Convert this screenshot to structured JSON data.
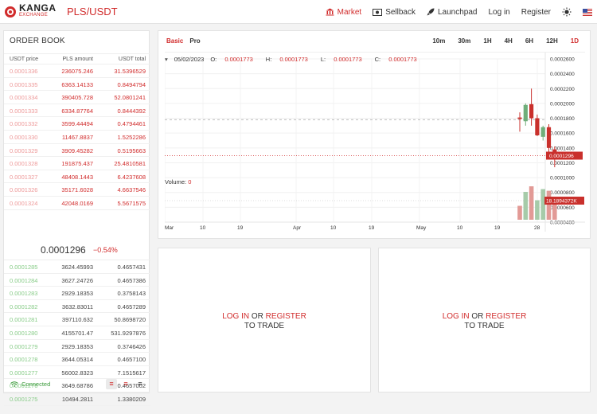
{
  "header": {
    "logo_text": "KANGA",
    "logo_sub": "EXCHANGE",
    "pair": "PLS/USDT",
    "nav": [
      {
        "label": "Market",
        "icon": "bank-icon",
        "active": true
      },
      {
        "label": "Sellback",
        "icon": "cash-icon",
        "active": false
      },
      {
        "label": "Launchpad",
        "icon": "rocket-icon",
        "active": false
      },
      {
        "label": "Log in",
        "icon": "",
        "active": false
      },
      {
        "label": "Register",
        "icon": "",
        "active": false
      }
    ]
  },
  "orderbook": {
    "title": "ORDER BOOK",
    "columns": [
      "USDT price",
      "PLS amount",
      "USDT total"
    ],
    "asks": [
      [
        "0.0001336",
        "236075.246",
        "31.5396529"
      ],
      [
        "0.0001335",
        "6363.14133",
        "0.8494794"
      ],
      [
        "0.0001334",
        "390405.728",
        "52.0801241"
      ],
      [
        "0.0001333",
        "6334.87764",
        "0.8444392"
      ],
      [
        "0.0001332",
        "3599.44494",
        "0.4794461"
      ],
      [
        "0.0001330",
        "11467.8837",
        "1.5252286"
      ],
      [
        "0.0001329",
        "3909.45282",
        "0.5195663"
      ],
      [
        "0.0001328",
        "191875.437",
        "25.4810581"
      ],
      [
        "0.0001327",
        "48408.1443",
        "6.4237608"
      ],
      [
        "0.0001326",
        "35171.6028",
        "4.6637546"
      ],
      [
        "0.0001324",
        "42048.0169",
        "5.5671575"
      ]
    ],
    "last_price": "0.0001296",
    "change": "−0.54%",
    "bids": [
      [
        "0.0001285",
        "3624.45993",
        "0.4657431"
      ],
      [
        "0.0001284",
        "3627.24726",
        "0.4657386"
      ],
      [
        "0.0001283",
        "2929.18353",
        "0.3758143"
      ],
      [
        "0.0001282",
        "3632.83011",
        "0.4657289"
      ],
      [
        "0.0001281",
        "397110.632",
        "50.8698720"
      ],
      [
        "0.0001280",
        "4155701.47",
        "531.9297876"
      ],
      [
        "0.0001279",
        "2929.18353",
        "0.3746426"
      ],
      [
        "0.0001278",
        "3644.05314",
        "0.4657100"
      ],
      [
        "0.0001277",
        "56002.8323",
        "7.1515617"
      ],
      [
        "0.0001276",
        "3649.68786",
        "0.4657002"
      ],
      [
        "0.0001275",
        "10494.2811",
        "1.3380209"
      ]
    ],
    "status": "Connected"
  },
  "chart": {
    "tabs": [
      {
        "label": "Basic",
        "active": true
      },
      {
        "label": "Pro",
        "active": false
      }
    ],
    "intervals": [
      {
        "label": "10m",
        "active": false
      },
      {
        "label": "30m",
        "active": false
      },
      {
        "label": "1H",
        "active": false
      },
      {
        "label": "4H",
        "active": false
      },
      {
        "label": "6H",
        "active": false
      },
      {
        "label": "12H",
        "active": false
      },
      {
        "label": "1D",
        "active": true
      }
    ],
    "date": "05/02/2023",
    "ohlc": [
      {
        "k": "O:",
        "v": "0.0001773"
      },
      {
        "k": "H:",
        "v": "0.0001773"
      },
      {
        "k": "L:",
        "v": "0.0001773"
      },
      {
        "k": "C:",
        "v": "0.0001773"
      }
    ],
    "volume_label": "Volume:",
    "volume_value": "0",
    "price_tag": "0.0001296",
    "volume_tag": "18.1894372K",
    "colors": {
      "up": "#6fae7a",
      "down": "#c9302c"
    }
  },
  "chart_data": {
    "type": "candlestick",
    "y_ticks": [
      "0.0002600",
      "0.0002400",
      "0.0002200",
      "0.0002000",
      "0.0001800",
      "0.0001600",
      "0.0001400",
      "0.0001200",
      "0.0001000",
      "0.0000800",
      "0.0000600",
      "0.0000400"
    ],
    "x_ticks": [
      "Mar",
      "10",
      "19",
      "Apr",
      "10",
      "19",
      "May",
      "10",
      "19",
      "28"
    ],
    "candles": [
      {
        "o": 0.000181,
        "h": 0.000188,
        "l": 0.000162,
        "c": 0.000179
      },
      {
        "o": 0.000176,
        "h": 0.0002,
        "l": 0.00017,
        "c": 0.000198
      },
      {
        "o": 0.000199,
        "h": 0.00022,
        "l": 0.00017,
        "c": 0.00018
      },
      {
        "o": 0.00018,
        "h": 0.000185,
        "l": 0.000156,
        "c": 0.000157
      },
      {
        "o": 0.000155,
        "h": 0.00017,
        "l": 0.00015,
        "c": 0.000168
      },
      {
        "o": 0.000168,
        "h": 0.000172,
        "l": 0.000132,
        "c": 0.00014
      },
      {
        "o": 0.000138,
        "h": 0.000142,
        "l": 0.000114,
        "c": 0.0001296
      }
    ],
    "volumes": [
      25,
      50,
      60,
      35,
      55,
      52,
      35
    ],
    "volume_up": [
      false,
      true,
      false,
      true,
      true,
      false,
      false
    ]
  },
  "trade_panels": [
    {
      "login": "LOG IN",
      "or": " OR ",
      "register": "REGISTER",
      "line2": "TO TRADE"
    },
    {
      "login": "LOG IN",
      "or": " OR ",
      "register": "REGISTER",
      "line2": "TO TRADE"
    }
  ]
}
